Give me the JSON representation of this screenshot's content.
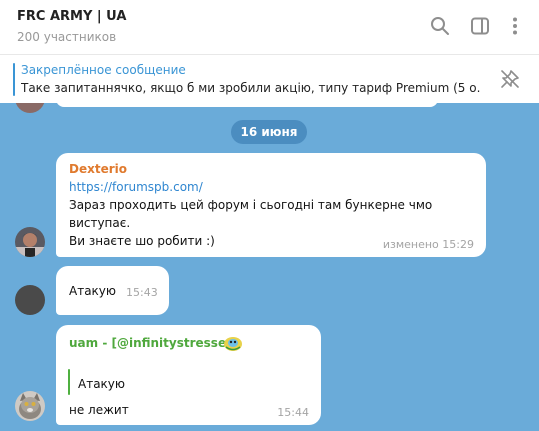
{
  "header": {
    "title": "FRC ARMY | UA",
    "subtitle": "200 участников",
    "icons": [
      "search-icon",
      "sidebar-toggle-icon",
      "more-vertical-icon"
    ]
  },
  "pinned": {
    "title": "Закреплённое сообщение",
    "text": "Таке запитаннячко, якщо б ми зробили акцію, типу тариф Premium (5 о...",
    "icon": "unpin-icon"
  },
  "chat": {
    "date_label": "16 июня",
    "messages": [
      {
        "sender": "Dexterio",
        "sender_color": "#e07a2e",
        "link": "https://forumspb.com/",
        "lines": [
          "Зараз проходить цей форум і сьогодні там бункерне чмо",
          "виступає.",
          "Ви знаєте шо робити :)"
        ],
        "time": "изменено 15:29"
      },
      {
        "text": "Атакую",
        "time": "15:43"
      },
      {
        "sender": "uam - [@infinitystresser]",
        "sender_color": "#4fa83d",
        "quote": "Атакую",
        "text": "не лежит",
        "time": "15:44"
      }
    ]
  },
  "colors": {
    "chat_background": "#6aabd9",
    "accent": "#3a95d5",
    "date_pill": "#4b8dc0"
  }
}
